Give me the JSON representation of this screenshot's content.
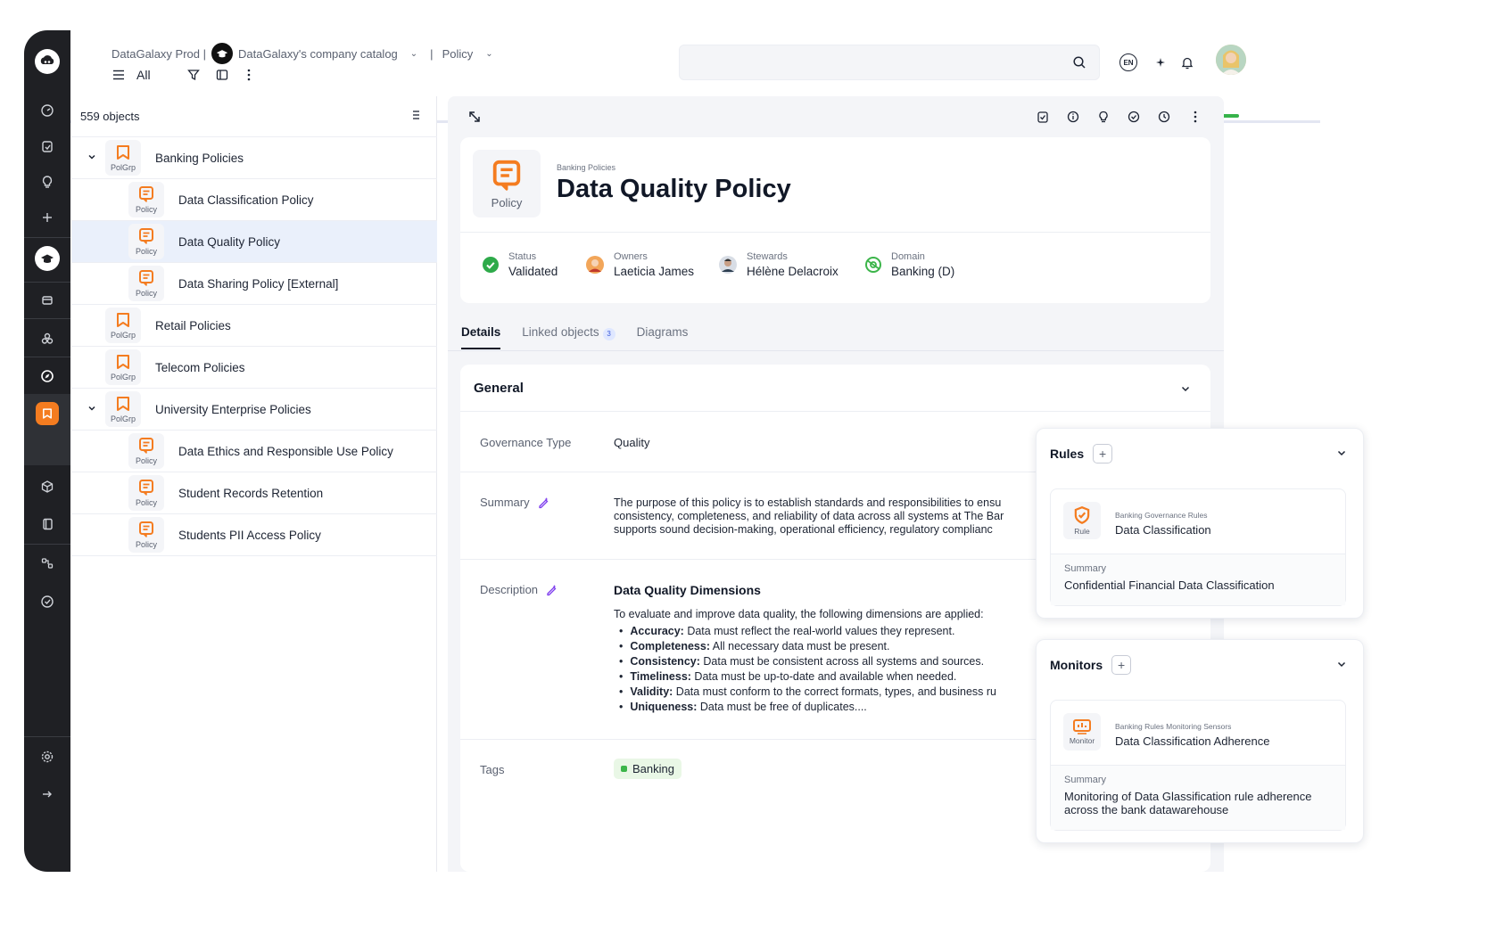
{
  "breadcrumb": {
    "workspace": "DataGalaxy Prod |",
    "catalog": "DataGalaxy's company catalog",
    "sep": "|",
    "module": "Policy"
  },
  "toolbar": {
    "filter_label": "All"
  },
  "header_right": {
    "lang": "EN"
  },
  "left_panel": {
    "count": "559 objects",
    "rows": [
      {
        "name": "Banking Policies",
        "type": "PolGrp",
        "level": 0,
        "expanded": true,
        "selected": false
      },
      {
        "name": "Data Classification Policy",
        "type": "Policy",
        "level": 1,
        "expanded": false,
        "selected": false
      },
      {
        "name": "Data Quality Policy",
        "type": "Policy",
        "level": 1,
        "expanded": false,
        "selected": true
      },
      {
        "name": "Data Sharing Policy [External]",
        "type": "Policy",
        "level": 1,
        "expanded": false,
        "selected": false
      },
      {
        "name": "Retail Policies",
        "type": "PolGrp",
        "level": 0,
        "expanded": false,
        "selected": false
      },
      {
        "name": "Telecom Policies",
        "type": "PolGrp",
        "level": 0,
        "expanded": false,
        "selected": false
      },
      {
        "name": "University Enterprise Policies",
        "type": "PolGrp",
        "level": 0,
        "expanded": true,
        "selected": false
      },
      {
        "name": "Data Ethics and Responsible Use Policy",
        "type": "Policy",
        "level": 1,
        "expanded": false,
        "selected": false
      },
      {
        "name": "Student Records Retention",
        "type": "Policy",
        "level": 1,
        "expanded": false,
        "selected": false
      },
      {
        "name": "Students PII Access Policy",
        "type": "Policy",
        "level": 1,
        "expanded": false,
        "selected": false
      }
    ]
  },
  "detail": {
    "type_label": "Policy",
    "parent": "Banking Policies",
    "title": "Data Quality Policy",
    "meta": {
      "status_key": "Status",
      "status_val": "Validated",
      "owners_key": "Owners",
      "owners_val": "Laeticia James",
      "stewards_key": "Stewards",
      "stewards_val": "Hélène Delacroix",
      "domain_key": "Domain",
      "domain_val": "Banking (D)"
    },
    "tabs": {
      "details": "Details",
      "linked": "Linked objects",
      "linked_count": "3",
      "diagrams": "Diagrams"
    },
    "general": {
      "title": "General",
      "gov_type_key": "Governance Type",
      "gov_type_val": "Quality",
      "summary_key": "Summary",
      "summary_lines": [
        "The purpose of this policy is to establish standards and responsibilities to ensu",
        "consistency, completeness, and reliability of data across all systems at The Bar",
        "supports sound decision-making, operational efficiency, regulatory complianc"
      ],
      "description_key": "Description",
      "description_title": "Data Quality Dimensions",
      "description_intro": "To evaluate and improve data quality, the following dimensions are applied:",
      "dimensions": [
        {
          "term": "Accuracy:",
          "text": " Data must reflect the real-world values they represent."
        },
        {
          "term": "Completeness:",
          "text": " All necessary data must be present."
        },
        {
          "term": "Consistency:",
          "text": " Data must be consistent across all systems and sources."
        },
        {
          "term": "Timeliness:",
          "text": " Data must be up-to-date and available when needed."
        },
        {
          "term": "Validity:",
          "text": " Data must conform to the correct formats, types, and business ru"
        },
        {
          "term": "Uniqueness:",
          "text": " Data must be free of duplicates...."
        }
      ],
      "tags_key": "Tags",
      "tag": "Banking"
    }
  },
  "rules_card": {
    "title": "Rules",
    "item": {
      "type": "Rule",
      "parent": "Banking Governance Rules",
      "name": "Data Classification",
      "summary_key": "Summary",
      "summary_val": "Confidential Financial Data Classification"
    }
  },
  "monitors_card": {
    "title": "Monitors",
    "item": {
      "type": "Monitor",
      "parent": "Banking Rules Monitoring Sensors",
      "name": "Data Classification Adherence",
      "summary_key": "Summary",
      "summary_val": "Monitoring of Data Glassification rule adherence across the bank datawarehouse"
    }
  },
  "colors": {
    "accent_orange": "#f47c20",
    "rail": "#1f2024",
    "selected_row": "#eaf0fb",
    "validated_green": "#2eaa4a"
  },
  "icons": [
    "home-logo-icon",
    "dashboard-icon",
    "tasks-icon",
    "bulb-icon",
    "plus-icon",
    "academy-icon",
    "store-icon",
    "glossary-icon",
    "compass-icon",
    "policy-icon",
    "cube-icon",
    "book-icon",
    "lineage-icon",
    "check-icon",
    "settings-icon",
    "arrow-right-icon",
    "search-icon",
    "sparkle-icon",
    "bell-icon",
    "expand-icon",
    "info-icon",
    "clock-icon",
    "more-icon"
  ]
}
